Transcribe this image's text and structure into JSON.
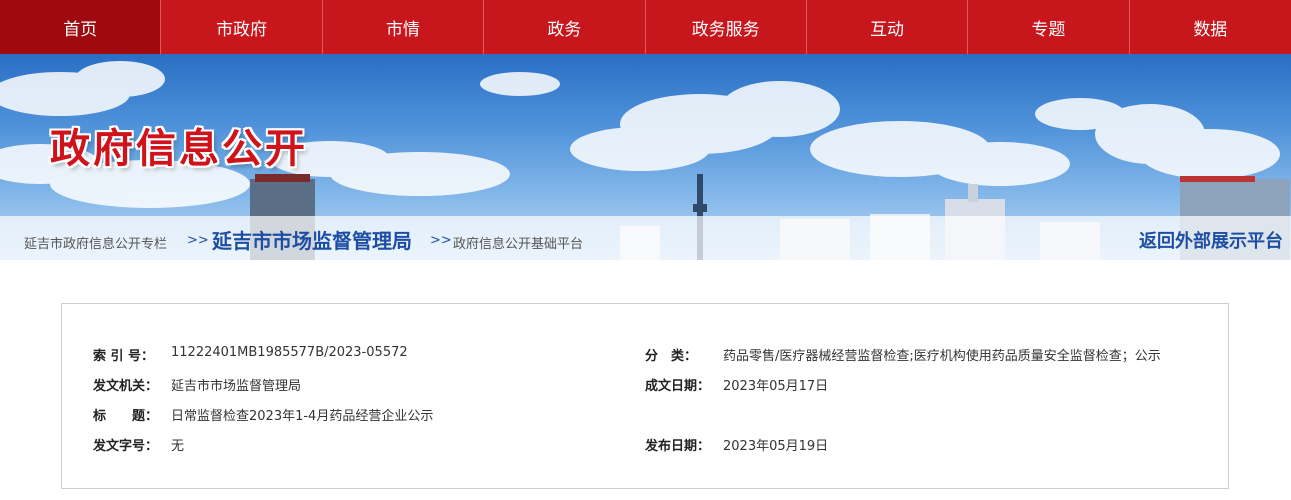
{
  "nav": {
    "items": [
      {
        "label": "首页"
      },
      {
        "label": "市政府"
      },
      {
        "label": "市情"
      },
      {
        "label": "政务"
      },
      {
        "label": "政务服务"
      },
      {
        "label": "互动"
      },
      {
        "label": "专题"
      },
      {
        "label": "数据"
      }
    ]
  },
  "banner": {
    "title": "政府信息公开"
  },
  "breadcrumb": {
    "root": "延吉市政府信息公开专栏",
    "sep1": ">>",
    "org": "延吉市市场监督管理局",
    "sep2": ">>",
    "sub": "政府信息公开基础平台",
    "return_link": "返回外部展示平台"
  },
  "info": {
    "index_label": "索 引 号：",
    "index_value": "11222401MB1985577B/2023-05572",
    "category_label": "分　类：",
    "category_value": "药品零售/医疗器械经营监督检查;医疗机构使用药品质量安全监督检查；公示",
    "issuer_label": "发文机关：",
    "issuer_value": "延吉市市场监督管理局",
    "created_label": "成文日期：",
    "created_value": "2023年05月17日",
    "title_label": "标　　题：",
    "title_value": "日常监督检查2023年1-4月药品经营企业公示",
    "docno_label": "发文字号：",
    "docno_value": "无",
    "published_label": "发布日期：",
    "published_value": "2023年05月19日"
  },
  "colors": {
    "nav_red": "#c8161d",
    "nav_active": "#9e0a0f",
    "link_blue": "#1e4ea3",
    "title_red": "#d0121b"
  }
}
